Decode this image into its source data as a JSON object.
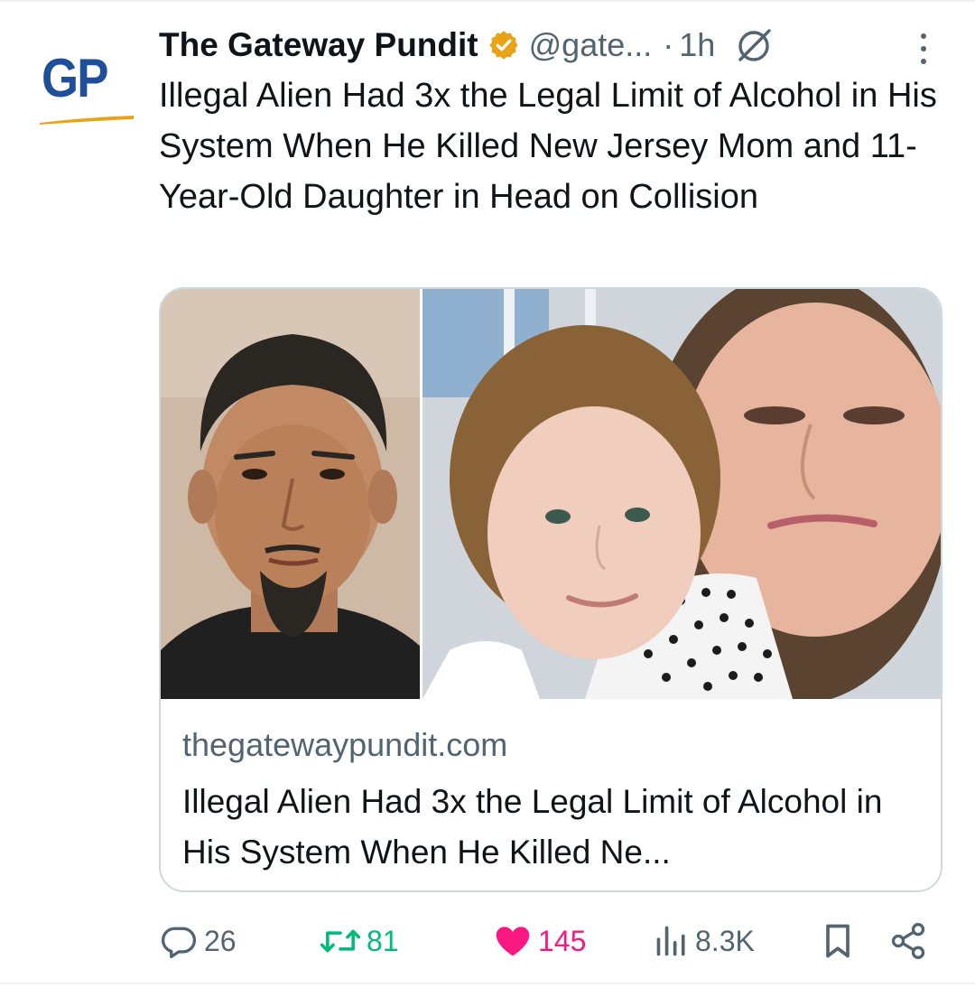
{
  "post": {
    "author": {
      "avatar_text": "GP",
      "display_name": "The Gateway Pundit",
      "handle": "@gate...",
      "verified": true,
      "verified_color": "#e8a317"
    },
    "separator": "·",
    "time": "1h",
    "text": "Illegal Alien Had 3x the Legal Limit of Alcohol in His System When He Killed New Jersey Mom and 11-Year-Old Daughter in Head on Collision",
    "card": {
      "domain": "thegatewaypundit.com",
      "title": "Illegal Alien Had 3x the Legal Limit of Alcohol in His System When He Killed Ne..."
    },
    "actions": {
      "reply_count": "26",
      "retweet_count": "81",
      "like_count": "145",
      "views_count": "8.3K",
      "liked": true
    },
    "icons": {
      "reply": "reply-icon",
      "retweet": "retweet-icon",
      "like": "heart-icon",
      "views": "views-icon",
      "bookmark": "bookmark-icon",
      "share": "share-icon",
      "grok": "grok-icon",
      "more": "more-icon"
    },
    "colors": {
      "avatar_text": "#1f4f9a",
      "avatar_swoosh": "#e8a317",
      "retweet": "#00ba7c",
      "like": "#f91880",
      "secondary_text": "#536471"
    }
  }
}
